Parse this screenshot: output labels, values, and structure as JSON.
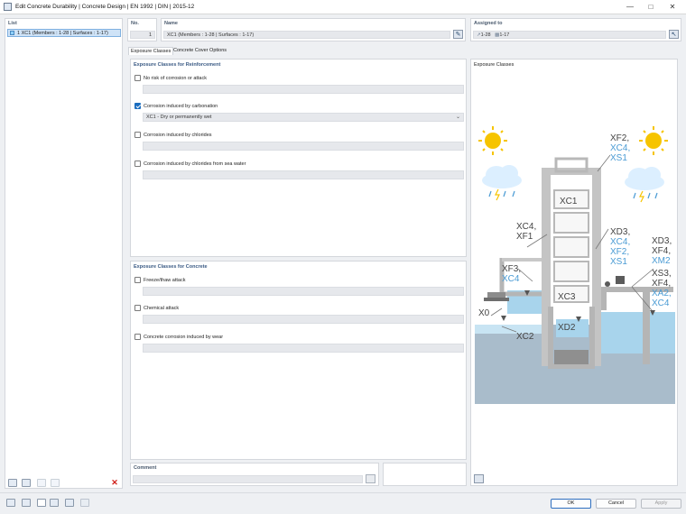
{
  "window": {
    "title": "Edit Concrete Durability | Concrete Design | EN 1992 | DIN | 2015-12"
  },
  "list": {
    "header": "List",
    "items": [
      {
        "label": "1 XC1 (Members : 1-28 | Surfaces : 1-17)"
      }
    ]
  },
  "no": {
    "header": "No.",
    "value": "1"
  },
  "name": {
    "header": "Name",
    "value": "XC1 (Members : 1-28 | Surfaces : 1-17)"
  },
  "assigned": {
    "header": "Assigned to",
    "members": "1-28",
    "surfaces": "1-17"
  },
  "tabs": [
    {
      "label": "Exposure Classes"
    },
    {
      "label": "Concrete Cover Options"
    }
  ],
  "reinforcement": {
    "title": "Exposure Classes for Reinforcement",
    "options": [
      {
        "label": "No risk of corrosion or attack",
        "checked": false,
        "value": ""
      },
      {
        "label": "Corrosion induced by carbonation",
        "checked": true,
        "value": "XC1 - Dry or permanently wet"
      },
      {
        "label": "Corrosion induced by chlorides",
        "checked": false,
        "value": ""
      },
      {
        "label": "Corrosion induced by chlorides from sea water",
        "checked": false,
        "value": ""
      }
    ]
  },
  "concrete": {
    "title": "Exposure Classes for Concrete",
    "options": [
      {
        "label": "Freeze/thaw attack",
        "checked": false
      },
      {
        "label": "Chemical attack",
        "checked": false
      },
      {
        "label": "Concrete corrosion induced by wear",
        "checked": false
      }
    ]
  },
  "comment": {
    "header": "Comment",
    "value": ""
  },
  "figure": {
    "title": "Exposure Classes",
    "labels": {
      "xf2": "XF2,",
      "xc4_a": "XC4,",
      "xs1_a": "XS1",
      "xc1": "XC1",
      "xc4_b": "XC4,",
      "xf1": "XF1",
      "xd3_a": "XD3,",
      "xc4_c": "XC4,",
      "xf2_b": "XF2,",
      "xs1_b": "XS1",
      "xd3_b": "XD3,",
      "xf4_a": "XF4,",
      "xm2": "XM2",
      "xf3": "XF3,",
      "xc4_d": "XC4",
      "xs3": "XS3,",
      "xf4_b": "XF4,",
      "xa2": "XA2,",
      "xc4_e": "XC4",
      "x0": "X0",
      "xc3": "XC3",
      "xd2": "XD2",
      "xc2": "XC2"
    }
  },
  "buttons": {
    "ok": "OK",
    "cancel": "Cancel",
    "apply": "Apply"
  },
  "colors": {
    "accent": "#1b6dbf",
    "water": "#a8d4ec",
    "ground": "#a9bccb",
    "structure": "#c8c8c8",
    "label_blue": "#4a9bd4"
  }
}
